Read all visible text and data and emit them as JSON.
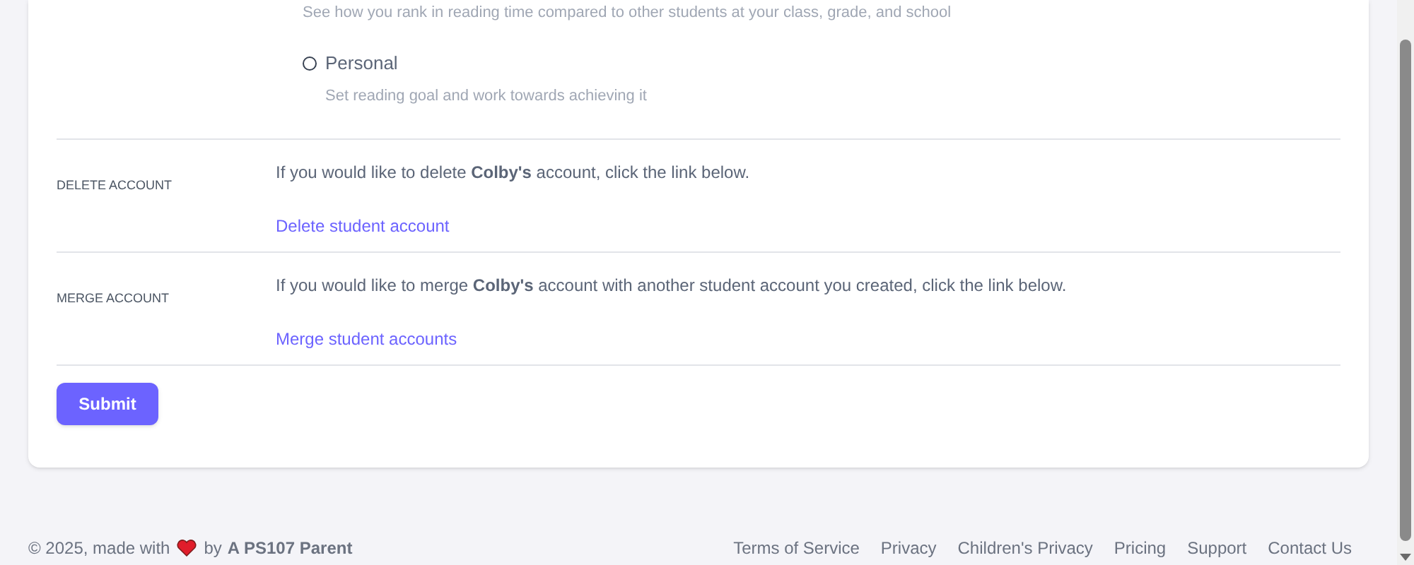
{
  "leaderboard_note": "See how you rank in reading time compared to other students at your class, grade, and school",
  "goal_option": {
    "label": "Personal",
    "selected": false,
    "description": "Set reading goal and work towards achieving it"
  },
  "sections": [
    {
      "heading": "DELETE ACCOUNT",
      "text": "If you would like to delete **Colby's** account, click the link below.",
      "link": "Delete student account"
    },
    {
      "heading": "MERGE ACCOUNT",
      "text": "If you would like to merge **Colby's** account with another student account you created, click the link below.",
      "link": "Merge student accounts"
    }
  ],
  "submit": "Submit",
  "footer": {
    "copyright": "© 2025, made with",
    "by": "by",
    "author": "A PS107 Parent",
    "links": [
      "Terms of Service",
      "Privacy",
      "Children's Privacy",
      "Pricing",
      "Support",
      "Contact Us"
    ]
  }
}
